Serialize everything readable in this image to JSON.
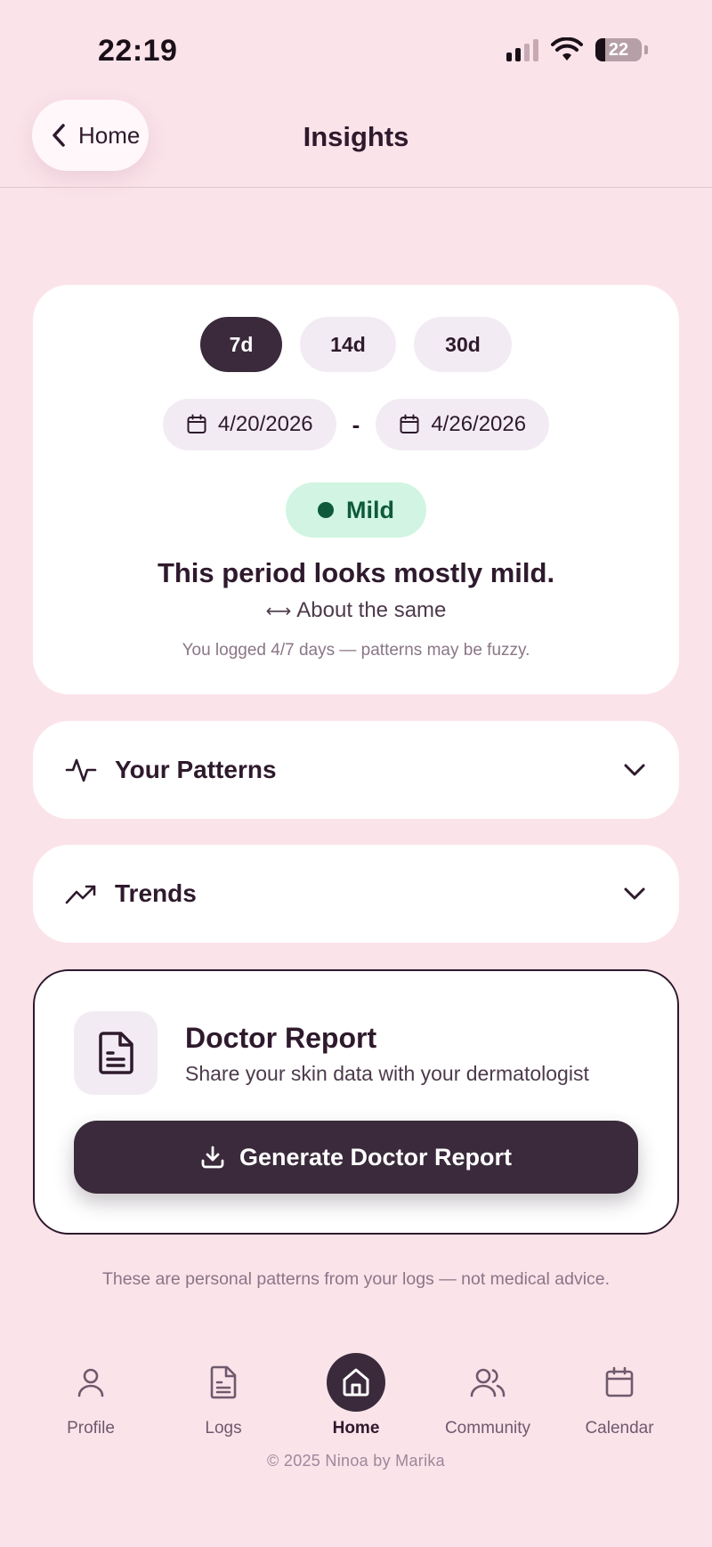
{
  "status_bar": {
    "time": "22:19",
    "battery": "22",
    "battery_level": 0.22
  },
  "header": {
    "back_label": "Home",
    "title": "Insights"
  },
  "summary": {
    "ranges": [
      {
        "label": "7d",
        "active": true
      },
      {
        "label": "14d",
        "active": false
      },
      {
        "label": "30d",
        "active": false
      }
    ],
    "date_start": "4/20/2026",
    "date_separator": "-",
    "date_end": "4/26/2026",
    "severity": "Mild",
    "headline": "This period looks mostly mild.",
    "trend_symbol": "⟷",
    "trend_text": "About the same",
    "logged_note": "You logged 4/7 days — patterns may be fuzzy."
  },
  "sections": {
    "patterns_title": "Your Patterns",
    "trends_title": "Trends"
  },
  "report": {
    "title": "Doctor Report",
    "subtitle": "Share your skin data with your dermatologist",
    "button_label": "Generate Doctor Report"
  },
  "disclaimer": "These are personal patterns from your logs — not medical advice.",
  "tabs": [
    {
      "label": "Profile",
      "icon": "profile-icon"
    },
    {
      "label": "Logs",
      "icon": "logs-icon"
    },
    {
      "label": "Home",
      "icon": "home-icon",
      "active": true
    },
    {
      "label": "Community",
      "icon": "community-icon"
    },
    {
      "label": "Calendar",
      "icon": "calendar-icon"
    }
  ],
  "footer": "© 2025 Ninoa by Marika",
  "colors": {
    "background": "#FBE3EA",
    "primary_dark": "#3A2A3B",
    "mild_bg": "#D1F5E2",
    "mild_text": "#0E5A3A",
    "chip_bg": "#F3EBF4"
  }
}
